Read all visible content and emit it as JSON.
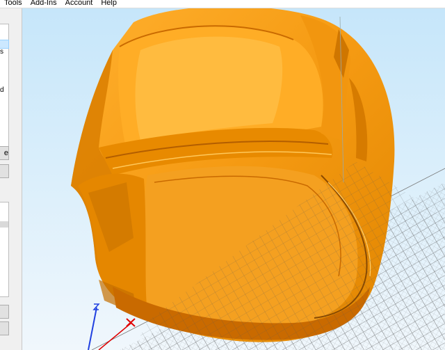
{
  "menu": {
    "items": [
      "Tools",
      "Add-Ins",
      "Account",
      "Help"
    ]
  },
  "left_panel": {
    "clipped_texts": [
      "s",
      "d"
    ],
    "buttons": [
      "e"
    ]
  },
  "viewport": {
    "model_color": "#f59a12",
    "model_shadow": "#c96a00",
    "model_highlight": "#ffc04a",
    "build_plate_grid": "#4d4d4d",
    "axis_x_color": "#e00000",
    "axis_z_color": "#2040e0"
  },
  "icons": {
    "axis_gizmo": "axis-gizmo-icon"
  }
}
